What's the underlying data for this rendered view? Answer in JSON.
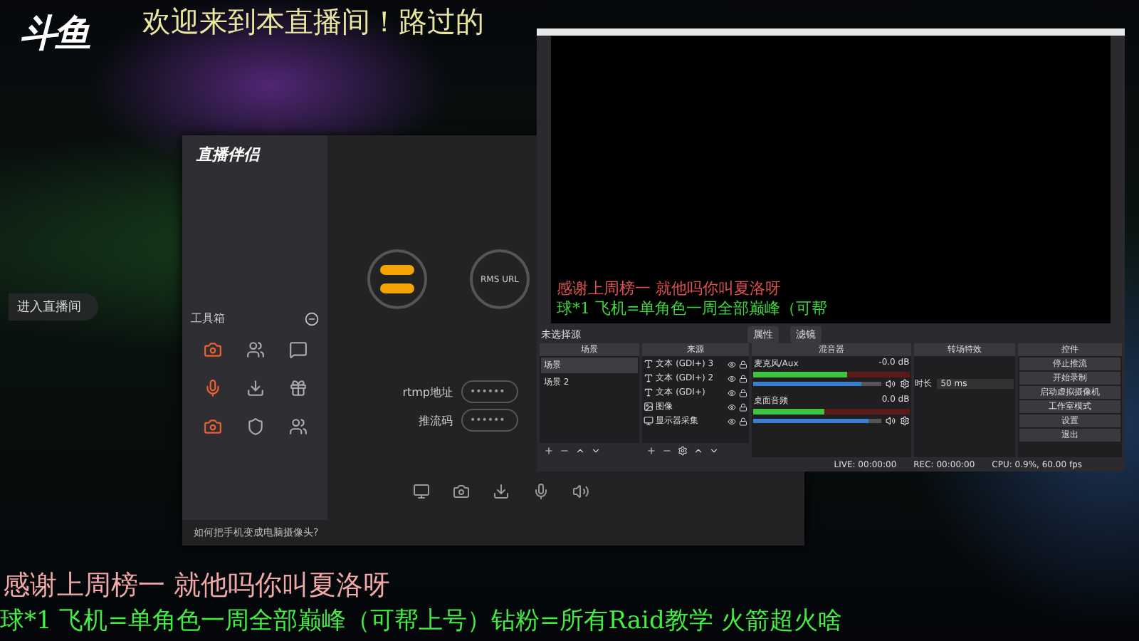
{
  "stream_logo": "斗鱼",
  "top_banner": "欢迎来到本直播间！路过的",
  "chat_notice": "进入直播间",
  "companion_app": {
    "title": "直播伴侣",
    "toolbox_label": "工具箱",
    "rms_label": "RMS URL",
    "fields": [
      {
        "label": "rtmp地址",
        "value": "••••••"
      },
      {
        "label": "推流码",
        "value": "••••••"
      }
    ],
    "hint": "如何把手机变成电脑摄像头?"
  },
  "obs": {
    "preview_captions": [
      "感谢上周榜一 就他吗你叫夏洛呀",
      "球*1 飞机=单角色一周全部巅峰（可帮"
    ],
    "source_bar": {
      "label": "未选择源",
      "buttons": [
        "属性",
        "滤镜"
      ]
    },
    "scenes": {
      "header": "场景",
      "items": [
        {
          "name": "场景",
          "selected": true
        },
        {
          "name": "场景 2",
          "selected": false
        }
      ]
    },
    "sources": {
      "header": "来源",
      "items": [
        {
          "name": "文本 (GDI+) 3",
          "kind": "text"
        },
        {
          "name": "文本 (GDI+) 2",
          "kind": "text"
        },
        {
          "name": "文本 (GDI+)",
          "kind": "text"
        },
        {
          "name": "图像",
          "kind": "image"
        },
        {
          "name": "显示器采集",
          "kind": "display"
        }
      ]
    },
    "mixer": {
      "header": "混音器",
      "channels": [
        {
          "name": "麦克风/Aux",
          "reading": "-0.0 dB",
          "meter": {
            "level": 0.6
          },
          "volume": {
            "level": 0.85
          }
        },
        {
          "name": "桌面音频",
          "reading": "0.0 dB",
          "meter": {
            "level": 0.45
          },
          "volume": {
            "level": 0.9
          }
        }
      ]
    },
    "transitions": {
      "header": "转场特效",
      "duration_label": "时长",
      "duration": "50 ms"
    },
    "controls": {
      "header": "控件",
      "buttons": [
        "停止推流",
        "开始录制",
        "启动虚拟摄像机",
        "工作室模式",
        "设置",
        "退出"
      ]
    },
    "status": [
      "LIVE: 00:00:00",
      "REC: 00:00:00",
      "CPU: 0.9%, 60.00 fps"
    ]
  },
  "captions": [
    "感谢上周榜一 就他吗你叫夏洛呀",
    "球*1 飞机=单角色一周全部巅峰（可帮上号）钻粉=所有Raid教学 火箭超火啥"
  ]
}
